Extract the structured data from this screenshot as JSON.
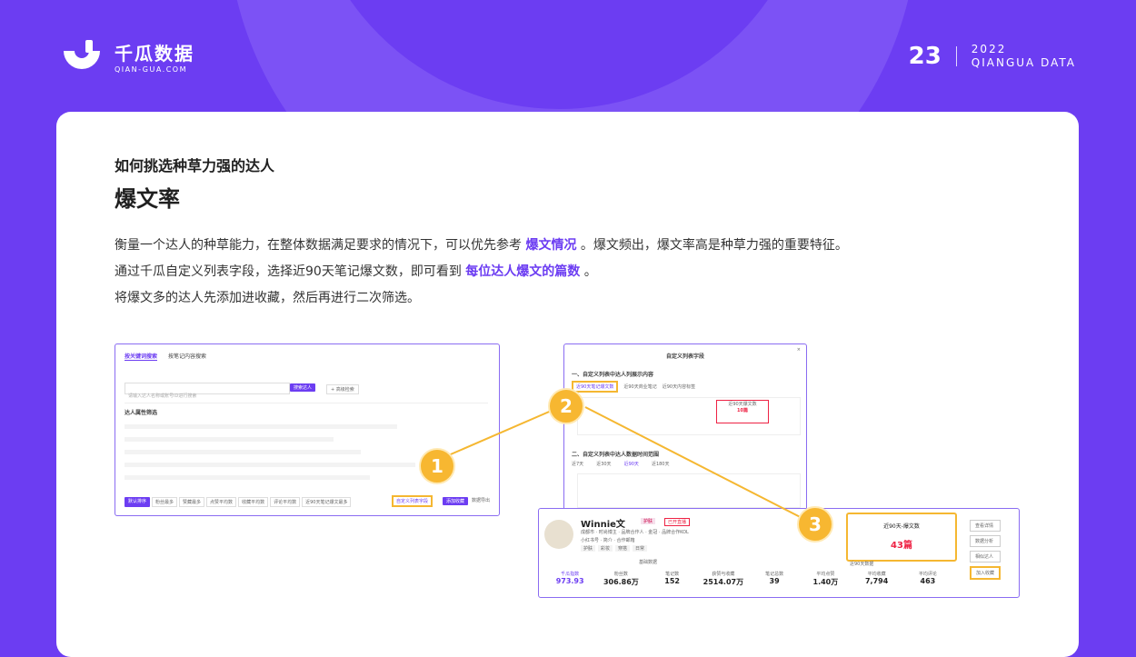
{
  "brand": {
    "name": "千瓜数据",
    "sub": "QIAN-GUA.COM"
  },
  "page": {
    "number": "23",
    "year": "2022",
    "org": "QIANGUA DATA"
  },
  "content": {
    "subtitle": "如何挑选种草力强的达人",
    "title": "爆文率",
    "line1_a": "衡量一个达人的种草能力，在整体数据满足要求的情况下，可以优先参考",
    "line1_hl": "爆文情况",
    "line1_b": "。爆文频出，爆文率高是种草力强的重要特征。",
    "line2_a": "通过千瓜自定义列表字段，选择近90天笔记爆文数，即可看到",
    "line2_hl": "每位达人爆文的篇数",
    "line2_b": "。",
    "line3": "将爆文多的达人先添加进收藏，然后再进行二次筛选。"
  },
  "search_panel": {
    "tab1": "按关键词搜索",
    "tab2": "按笔记内容搜索",
    "placeholder": "请输入达人名称或账号ID进行搜索",
    "search_btn": "搜索达人",
    "advanced": "+ 高级检索",
    "section": "达人属性筛选",
    "bottom_tabs": [
      "默认排序",
      "粉丝最多",
      "赞藏最多",
      "点赞平均数",
      "收藏平均数",
      "评论平均数",
      "近90天笔记爆文最多"
    ],
    "custom_btn": "自定义列表字段",
    "batch_btn": "添加收藏",
    "export_btn": "数据导出"
  },
  "dialog": {
    "title": "自定义列表字段",
    "section1": "一、自定义列表中达人列展示内容",
    "opt1": "近90天笔记爆文数",
    "opt2": "近90天商业笔记",
    "opt3": "近90天内容标签",
    "mini_header": "近90天爆文数",
    "mini_value": "10篇",
    "section2": "二、自定义列表中达人数据时间范围",
    "ranges": [
      "近7天",
      "近30天",
      "近90天",
      "近180天"
    ]
  },
  "profile": {
    "name": "Winnie文",
    "badge": "护肤",
    "live": "已开直播",
    "tags_line": "成都市 · 时尚博主 · 品牌合作人 · 金冠 · 品牌合作KOL",
    "id_line": "小红书号 · 简介 · 合作邮箱",
    "chips": [
      "护肤",
      "彩妆",
      "穿搭",
      "日常"
    ],
    "bowen_label": "近90天-爆文数",
    "bowen_value": "43篇",
    "group1": "基础数据",
    "group2": "近90天数据",
    "stats": [
      {
        "label": "千瓜指数",
        "value": "973.93"
      },
      {
        "label": "粉丝数",
        "value": "306.86万"
      },
      {
        "label": "笔记数",
        "value": "152"
      },
      {
        "label": "获赞与收藏",
        "value": "2514.07万"
      },
      {
        "label": "笔记总数",
        "value": "39"
      },
      {
        "label": "平均点赞",
        "value": "1.40万"
      },
      {
        "label": "平均收藏",
        "value": "7,794"
      },
      {
        "label": "平均评论",
        "value": "463"
      }
    ],
    "actions": [
      "查看详情",
      "数据分析",
      "相似达人",
      "加入收藏"
    ]
  },
  "callouts": [
    "1",
    "2",
    "3"
  ]
}
